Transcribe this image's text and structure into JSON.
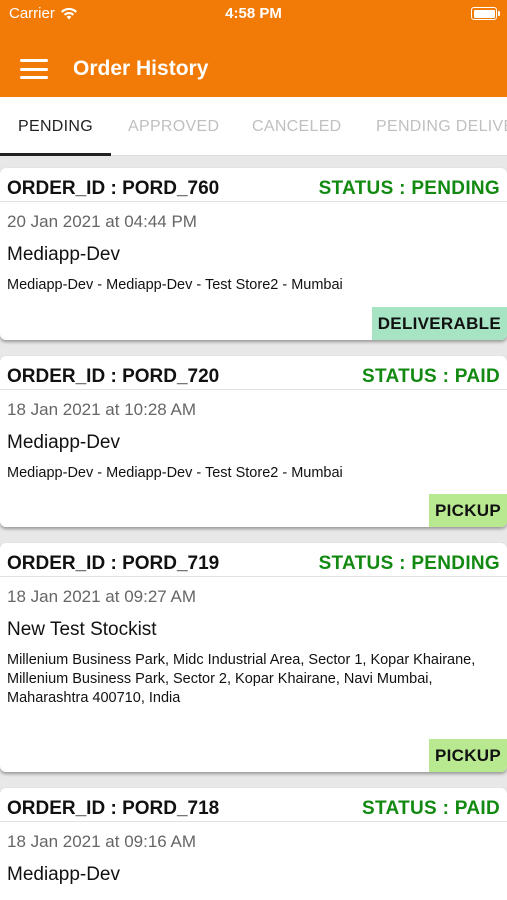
{
  "status_bar": {
    "carrier": "Carrier",
    "time": "4:58 PM"
  },
  "header": {
    "title": "Order History"
  },
  "tabs": [
    {
      "label": "PENDING",
      "active": true
    },
    {
      "label": "APPROVED",
      "active": false
    },
    {
      "label": "CANCELED",
      "active": false
    },
    {
      "label": "PENDING DELIVERY",
      "active": false
    }
  ],
  "orders": [
    {
      "order_id": "ORDER_ID : PORD_760",
      "status": "STATUS : PENDING",
      "date": "20 Jan 2021 at 04:44 PM",
      "name": "Mediapp-Dev",
      "address": "Mediapp-Dev - Mediapp-Dev - Test Store2  - Mumbai",
      "badge": "DELIVERABLE"
    },
    {
      "order_id": "ORDER_ID : PORD_720",
      "status": "STATUS : PAID",
      "date": "18 Jan 2021 at 10:28 AM",
      "name": "Mediapp-Dev",
      "address": "Mediapp-Dev - Mediapp-Dev - Test Store2  - Mumbai",
      "badge": "PICKUP"
    },
    {
      "order_id": "ORDER_ID : PORD_719",
      "status": "STATUS : PENDING",
      "date": "18 Jan 2021 at 09:27 AM",
      "name": "New Test Stockist",
      "address": "Millenium Business Park, Midc Industrial Area, Sector 1, Kopar Khairane, Millenium Business Park, Sector 2, Kopar Khairane, Navi Mumbai, Maharashtra 400710, India",
      "badge": "PICKUP"
    },
    {
      "order_id": "ORDER_ID : PORD_718",
      "status": "STATUS : PAID",
      "date": "18 Jan 2021 at 09:16 AM",
      "name": "Mediapp-Dev"
    }
  ],
  "colors": {
    "header_bg": "#f27a06",
    "status_green": "#128a12",
    "deliverable_badge": "#a6e4c3",
    "pickup_badge": "#b8e890"
  },
  "icons": {
    "wifi": "wifi-icon",
    "battery": "battery-icon",
    "menu": "hamburger-menu-icon"
  }
}
